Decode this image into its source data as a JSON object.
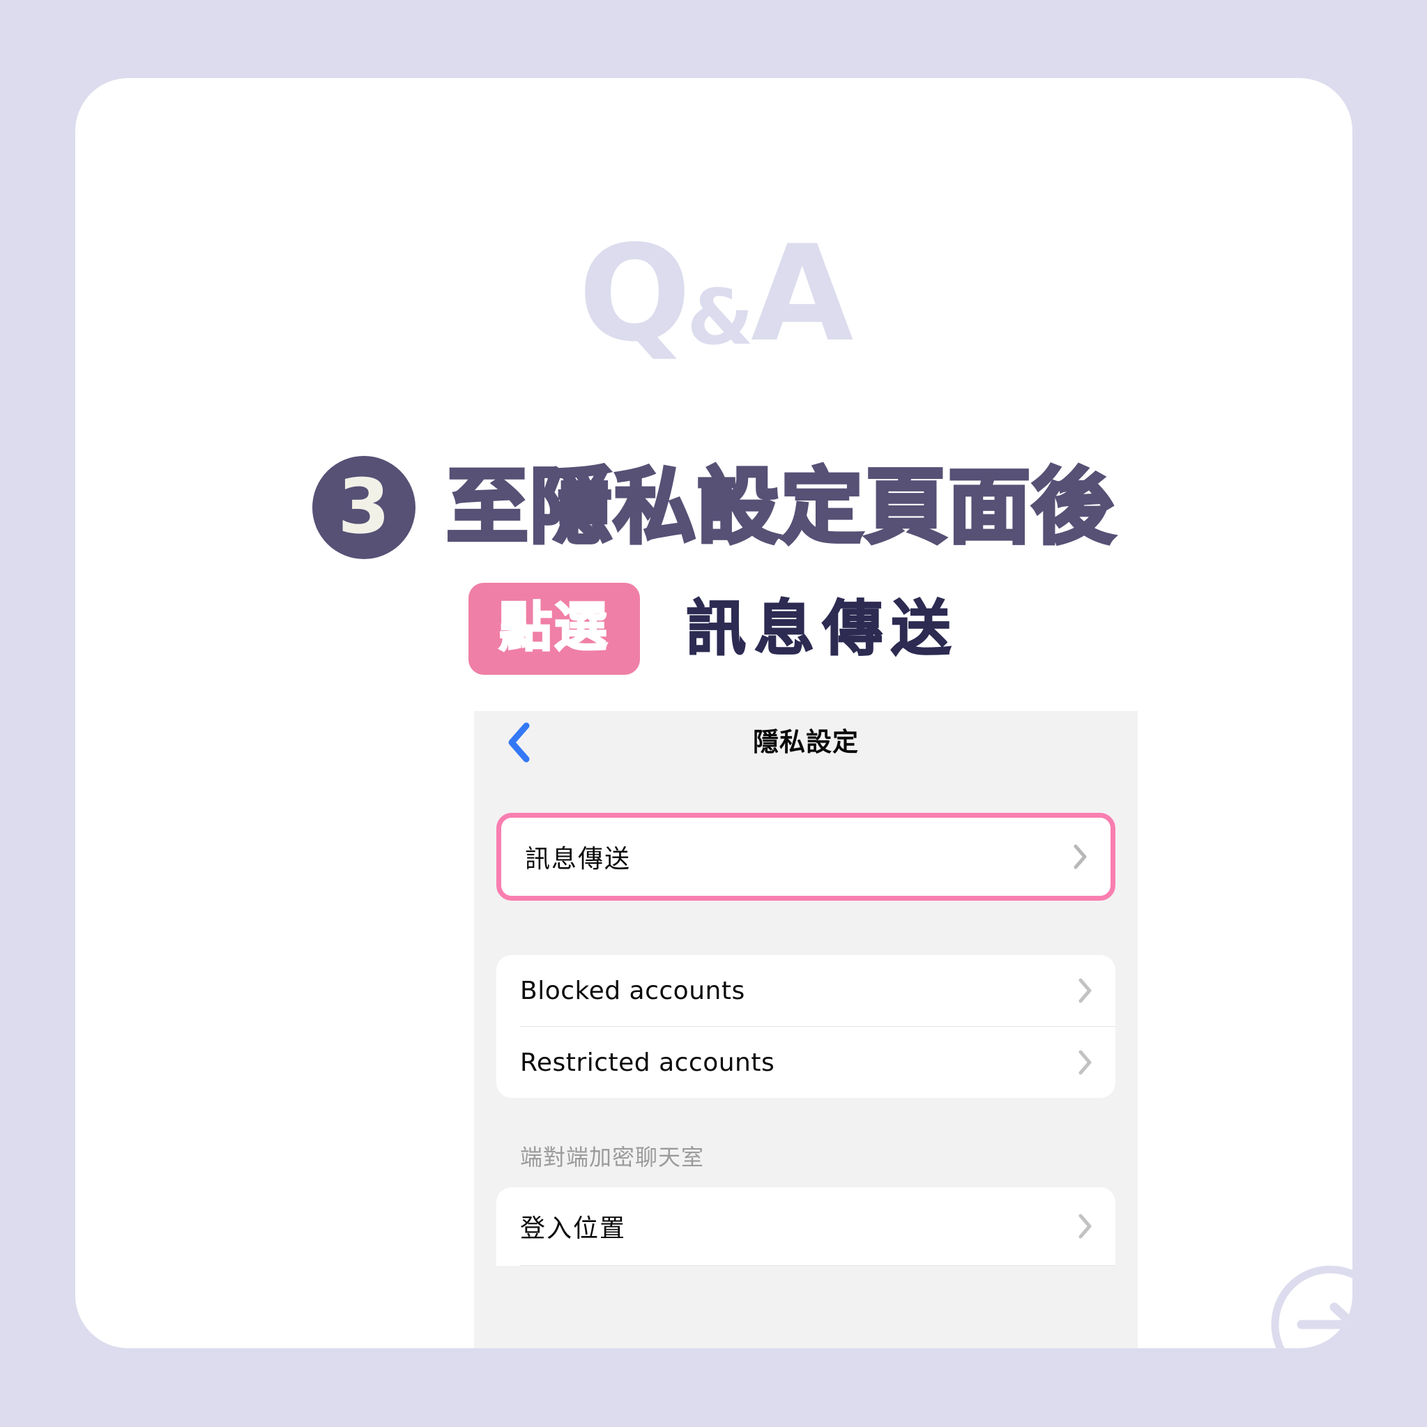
{
  "theme": {
    "background": "#dcdcee",
    "card_background": "#ffffff",
    "accent_purple": "#565175",
    "accent_pink": "#ef7fa6",
    "highlight_pink": "#f97eb0",
    "subtitle_navy": "#2d2b52",
    "watermark_lavender": "#dcdcee",
    "ios_blue": "#3478f6"
  },
  "watermark": {
    "q": "Q",
    "amp": "&",
    "a": "A"
  },
  "heading": {
    "step_number": "3",
    "text": "至隱私設定頁面後"
  },
  "subheading": {
    "pill_label": "點選",
    "label": "訊息傳送"
  },
  "phone": {
    "navbar": {
      "back_label": "",
      "title": "隱私設定"
    },
    "highlighted_row": {
      "label": "訊息傳送"
    },
    "accounts_group": [
      {
        "label": "Blocked accounts"
      },
      {
        "label": "Restricted accounts"
      }
    ],
    "section_title": "端對端加密聊天室",
    "encrypted_group": [
      {
        "label": "登入位置"
      }
    ]
  },
  "next_button": {
    "icon": "arrow-right-circle-icon"
  }
}
